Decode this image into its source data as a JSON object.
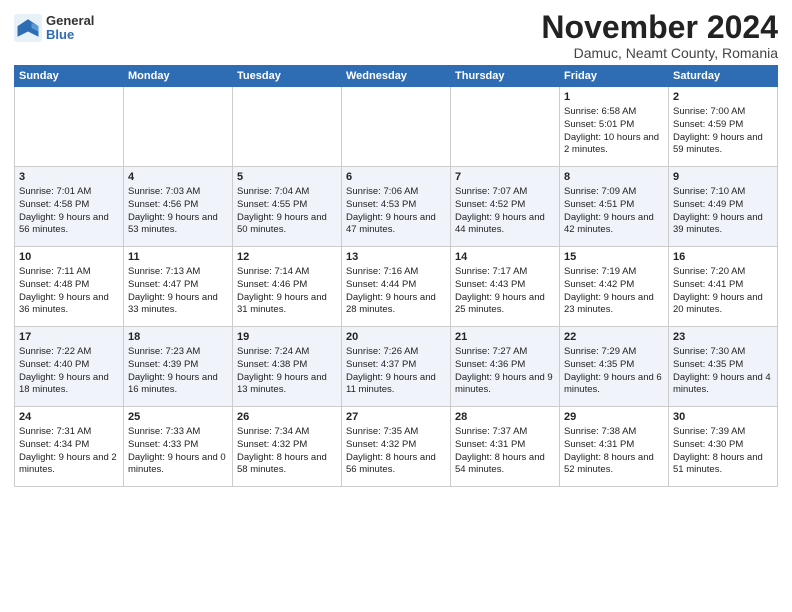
{
  "header": {
    "logo_general": "General",
    "logo_blue": "Blue",
    "month_title": "November 2024",
    "location": "Damuc, Neamt County, Romania"
  },
  "days_of_week": [
    "Sunday",
    "Monday",
    "Tuesday",
    "Wednesday",
    "Thursday",
    "Friday",
    "Saturday"
  ],
  "weeks": [
    [
      {
        "day": "",
        "info": ""
      },
      {
        "day": "",
        "info": ""
      },
      {
        "day": "",
        "info": ""
      },
      {
        "day": "",
        "info": ""
      },
      {
        "day": "",
        "info": ""
      },
      {
        "day": "1",
        "info": "Sunrise: 6:58 AM\nSunset: 5:01 PM\nDaylight: 10 hours and 2 minutes."
      },
      {
        "day": "2",
        "info": "Sunrise: 7:00 AM\nSunset: 4:59 PM\nDaylight: 9 hours and 59 minutes."
      }
    ],
    [
      {
        "day": "3",
        "info": "Sunrise: 7:01 AM\nSunset: 4:58 PM\nDaylight: 9 hours and 56 minutes."
      },
      {
        "day": "4",
        "info": "Sunrise: 7:03 AM\nSunset: 4:56 PM\nDaylight: 9 hours and 53 minutes."
      },
      {
        "day": "5",
        "info": "Sunrise: 7:04 AM\nSunset: 4:55 PM\nDaylight: 9 hours and 50 minutes."
      },
      {
        "day": "6",
        "info": "Sunrise: 7:06 AM\nSunset: 4:53 PM\nDaylight: 9 hours and 47 minutes."
      },
      {
        "day": "7",
        "info": "Sunrise: 7:07 AM\nSunset: 4:52 PM\nDaylight: 9 hours and 44 minutes."
      },
      {
        "day": "8",
        "info": "Sunrise: 7:09 AM\nSunset: 4:51 PM\nDaylight: 9 hours and 42 minutes."
      },
      {
        "day": "9",
        "info": "Sunrise: 7:10 AM\nSunset: 4:49 PM\nDaylight: 9 hours and 39 minutes."
      }
    ],
    [
      {
        "day": "10",
        "info": "Sunrise: 7:11 AM\nSunset: 4:48 PM\nDaylight: 9 hours and 36 minutes."
      },
      {
        "day": "11",
        "info": "Sunrise: 7:13 AM\nSunset: 4:47 PM\nDaylight: 9 hours and 33 minutes."
      },
      {
        "day": "12",
        "info": "Sunrise: 7:14 AM\nSunset: 4:46 PM\nDaylight: 9 hours and 31 minutes."
      },
      {
        "day": "13",
        "info": "Sunrise: 7:16 AM\nSunset: 4:44 PM\nDaylight: 9 hours and 28 minutes."
      },
      {
        "day": "14",
        "info": "Sunrise: 7:17 AM\nSunset: 4:43 PM\nDaylight: 9 hours and 25 minutes."
      },
      {
        "day": "15",
        "info": "Sunrise: 7:19 AM\nSunset: 4:42 PM\nDaylight: 9 hours and 23 minutes."
      },
      {
        "day": "16",
        "info": "Sunrise: 7:20 AM\nSunset: 4:41 PM\nDaylight: 9 hours and 20 minutes."
      }
    ],
    [
      {
        "day": "17",
        "info": "Sunrise: 7:22 AM\nSunset: 4:40 PM\nDaylight: 9 hours and 18 minutes."
      },
      {
        "day": "18",
        "info": "Sunrise: 7:23 AM\nSunset: 4:39 PM\nDaylight: 9 hours and 16 minutes."
      },
      {
        "day": "19",
        "info": "Sunrise: 7:24 AM\nSunset: 4:38 PM\nDaylight: 9 hours and 13 minutes."
      },
      {
        "day": "20",
        "info": "Sunrise: 7:26 AM\nSunset: 4:37 PM\nDaylight: 9 hours and 11 minutes."
      },
      {
        "day": "21",
        "info": "Sunrise: 7:27 AM\nSunset: 4:36 PM\nDaylight: 9 hours and 9 minutes."
      },
      {
        "day": "22",
        "info": "Sunrise: 7:29 AM\nSunset: 4:35 PM\nDaylight: 9 hours and 6 minutes."
      },
      {
        "day": "23",
        "info": "Sunrise: 7:30 AM\nSunset: 4:35 PM\nDaylight: 9 hours and 4 minutes."
      }
    ],
    [
      {
        "day": "24",
        "info": "Sunrise: 7:31 AM\nSunset: 4:34 PM\nDaylight: 9 hours and 2 minutes."
      },
      {
        "day": "25",
        "info": "Sunrise: 7:33 AM\nSunset: 4:33 PM\nDaylight: 9 hours and 0 minutes."
      },
      {
        "day": "26",
        "info": "Sunrise: 7:34 AM\nSunset: 4:32 PM\nDaylight: 8 hours and 58 minutes."
      },
      {
        "day": "27",
        "info": "Sunrise: 7:35 AM\nSunset: 4:32 PM\nDaylight: 8 hours and 56 minutes."
      },
      {
        "day": "28",
        "info": "Sunrise: 7:37 AM\nSunset: 4:31 PM\nDaylight: 8 hours and 54 minutes."
      },
      {
        "day": "29",
        "info": "Sunrise: 7:38 AM\nSunset: 4:31 PM\nDaylight: 8 hours and 52 minutes."
      },
      {
        "day": "30",
        "info": "Sunrise: 7:39 AM\nSunset: 4:30 PM\nDaylight: 8 hours and 51 minutes."
      }
    ]
  ]
}
